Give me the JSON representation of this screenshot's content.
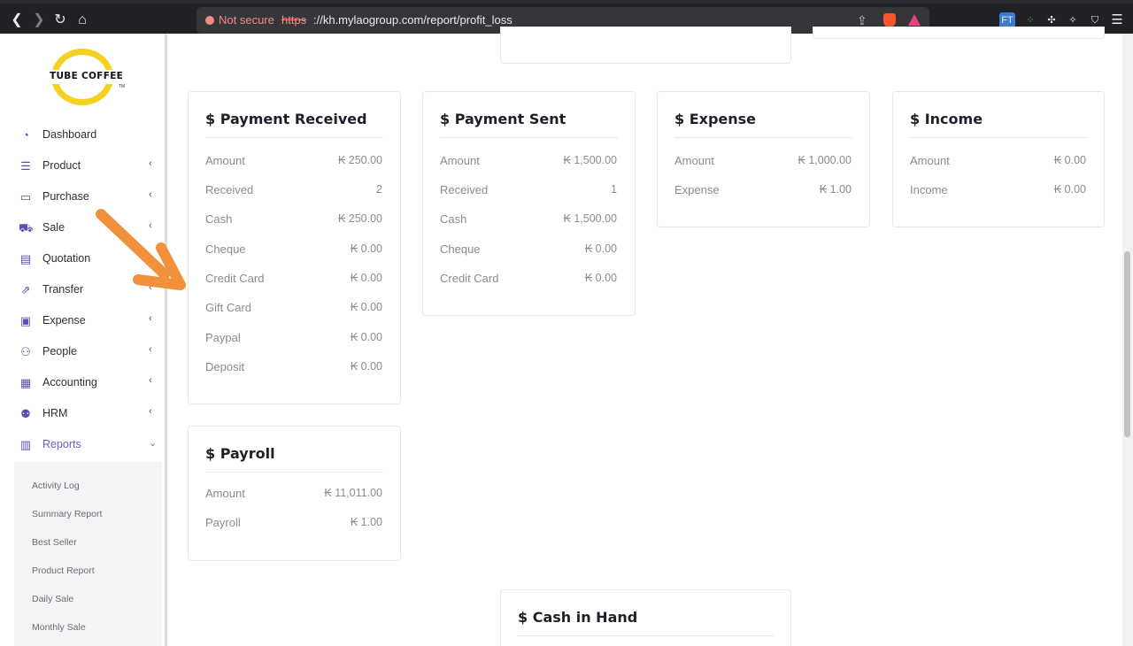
{
  "browser": {
    "security": "Not secure",
    "url_scheme": "https",
    "url_rest": "://kh.mylaogroup.com/report/profit_loss",
    "extensions": [
      "FT"
    ]
  },
  "sidebar": {
    "logo_text": "TUBE COFFEE",
    "logo_tm": "TM",
    "items": [
      {
        "label": "Dashboard",
        "icon": "gauge-icon",
        "glyph": "◔",
        "chev": ""
      },
      {
        "label": "Product",
        "icon": "list-icon",
        "glyph": "☰",
        "chev": "‹"
      },
      {
        "label": "Purchase",
        "icon": "card-icon",
        "glyph": "▭",
        "chev": "‹"
      },
      {
        "label": "Sale",
        "icon": "cart-icon",
        "glyph": "⛟",
        "chev": "‹"
      },
      {
        "label": "Quotation",
        "icon": "document-icon",
        "glyph": "▤",
        "chev": ""
      },
      {
        "label": "Transfer",
        "icon": "share-icon",
        "glyph": "⇗",
        "chev": "‹"
      },
      {
        "label": "Expense",
        "icon": "wallet-icon",
        "glyph": "▣",
        "chev": "‹"
      },
      {
        "label": "People",
        "icon": "user-icon",
        "glyph": "⚇",
        "chev": "‹"
      },
      {
        "label": "Accounting",
        "icon": "briefcase-icon",
        "glyph": "▦",
        "chev": "‹"
      },
      {
        "label": "HRM",
        "icon": "users-icon",
        "glyph": "⚉",
        "chev": "‹"
      },
      {
        "label": "Reports",
        "icon": "file-icon",
        "glyph": "▥",
        "chev": "⌄"
      }
    ],
    "sub_items": [
      "Activity Log",
      "Summary Report",
      "Best Seller",
      "Product Report",
      "Daily Sale",
      "Monthly Sale"
    ]
  },
  "cards": {
    "payment_received": {
      "title": "$ Payment Received",
      "rows": [
        {
          "label": "Amount",
          "value": "₭ 250.00"
        },
        {
          "label": "Received",
          "value": "2"
        },
        {
          "label": "Cash",
          "value": "₭ 250.00"
        },
        {
          "label": "Cheque",
          "value": "₭ 0.00"
        },
        {
          "label": "Credit Card",
          "value": "₭ 0.00"
        },
        {
          "label": "Gift Card",
          "value": "₭ 0.00"
        },
        {
          "label": "Paypal",
          "value": "₭ 0.00"
        },
        {
          "label": "Deposit",
          "value": "₭ 0.00"
        }
      ]
    },
    "payment_sent": {
      "title": "$ Payment Sent",
      "rows": [
        {
          "label": "Amount",
          "value": "₭ 1,500.00"
        },
        {
          "label": "Received",
          "value": "1"
        },
        {
          "label": "Cash",
          "value": "₭ 1,500.00"
        },
        {
          "label": "Cheque",
          "value": "₭ 0.00"
        },
        {
          "label": "Credit Card",
          "value": "₭ 0.00"
        }
      ]
    },
    "expense": {
      "title": "$ Expense",
      "rows": [
        {
          "label": "Amount",
          "value": "₭ 1,000.00"
        },
        {
          "label": "Expense",
          "value": "₭ 1.00"
        }
      ]
    },
    "income": {
      "title": "$ Income",
      "rows": [
        {
          "label": "Amount",
          "value": "₭ 0.00"
        },
        {
          "label": "Income",
          "value": "₭ 0.00"
        }
      ]
    },
    "payroll": {
      "title": "$ Payroll",
      "rows": [
        {
          "label": "Amount",
          "value": "₭ 11,011.00"
        },
        {
          "label": "Payroll",
          "value": "₭ 1.00"
        }
      ]
    },
    "cash_in_hand": {
      "title": "$ Cash in Hand"
    }
  },
  "colors": {
    "accent": "#6b5fc7",
    "logo_yellow": "#f4d21f",
    "annotation_arrow": "#f2913c"
  }
}
